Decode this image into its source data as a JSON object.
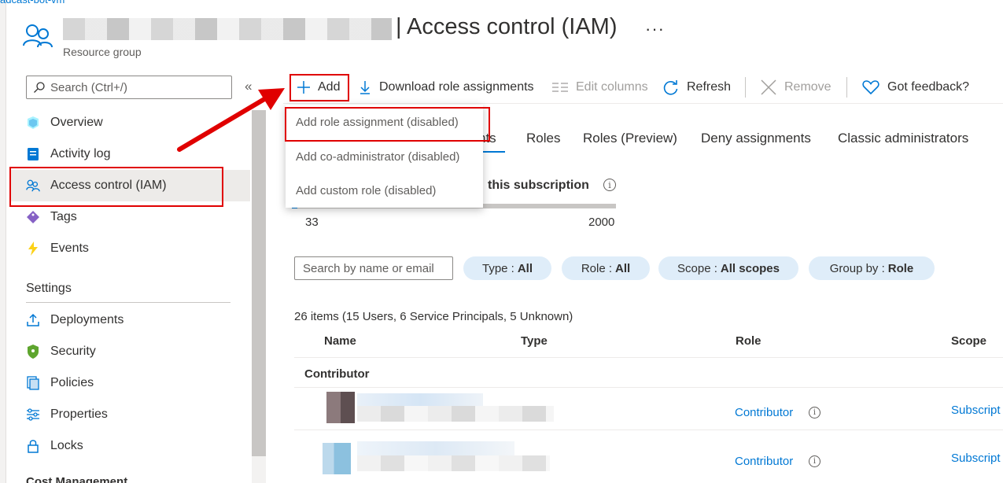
{
  "breadcrumb": "adcast-bot-vm",
  "header": {
    "title": "| Access control (IAM)",
    "subtitle": "Resource group",
    "more": "···"
  },
  "sidebar": {
    "search_placeholder": "Search (Ctrl+/)",
    "collapse": "«",
    "items": [
      {
        "label": "Overview",
        "icon": "overview-icon"
      },
      {
        "label": "Activity log",
        "icon": "activity-log-icon"
      },
      {
        "label": "Access control (IAM)",
        "icon": "iam-icon"
      },
      {
        "label": "Tags",
        "icon": "tag-icon"
      },
      {
        "label": "Events",
        "icon": "lightning-icon"
      }
    ],
    "settings_heading": "Settings",
    "settings_items": [
      {
        "label": "Deployments",
        "icon": "upload-icon"
      },
      {
        "label": "Security",
        "icon": "shield-icon"
      },
      {
        "label": "Policies",
        "icon": "policy-icon"
      },
      {
        "label": "Properties",
        "icon": "properties-icon"
      },
      {
        "label": "Locks",
        "icon": "lock-icon"
      }
    ],
    "cut_heading": "Cost Management"
  },
  "toolbar": {
    "add": "Add",
    "download": "Download role assignments",
    "edit_columns": "Edit columns",
    "refresh": "Refresh",
    "remove": "Remove",
    "feedback": "Got feedback?"
  },
  "dropdown": {
    "items": [
      "Add role assignment (disabled)",
      "Add co-administrator (disabled)",
      "Add custom role (disabled)"
    ]
  },
  "tabs": {
    "partial": "nts",
    "roles": "Roles",
    "roles_preview": "Roles (Preview)",
    "deny": "Deny assignments",
    "classic": "Classic administrators"
  },
  "limits": {
    "title_partial": "this subscription",
    "current": "33",
    "max": "2000",
    "fraction": 0.0165
  },
  "filters": {
    "search_placeholder": "Search by name or email",
    "type_label": "Type :",
    "type_value": "All",
    "role_label": "Role :",
    "role_value": "All",
    "scope_label": "Scope :",
    "scope_value": "All scopes",
    "group_label": "Group by :",
    "group_value": "Role"
  },
  "table": {
    "count": "26 items (15 Users, 6 Service Principals, 5 Unknown)",
    "columns": [
      "Name",
      "Type",
      "Role",
      "Scope"
    ],
    "group": "Contributor",
    "rows": [
      {
        "role": "Contributor",
        "scope": "Subscript"
      },
      {
        "role": "Contributor",
        "scope": "Subscript"
      }
    ]
  },
  "colors": {
    "accent": "#0078d4",
    "highlight": "#e00000",
    "pill": "#dfedf9"
  }
}
